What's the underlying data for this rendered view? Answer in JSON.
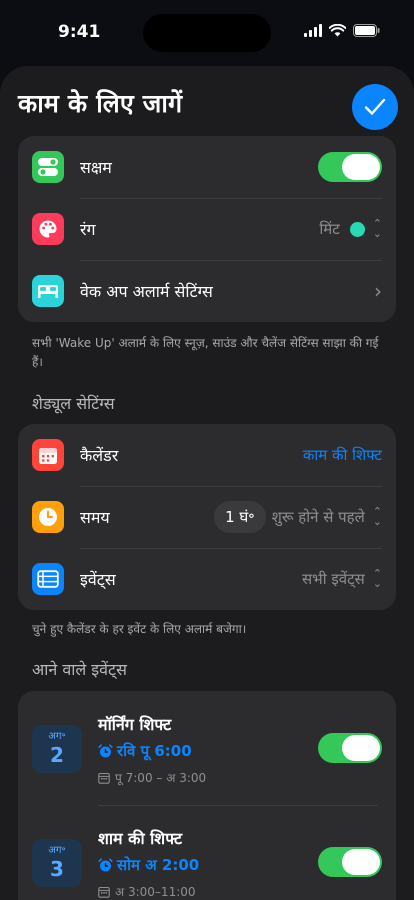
{
  "status_bar": {
    "time": "9:41"
  },
  "sheet": {
    "title": "काम के लिए जागें"
  },
  "settings": {
    "enabled_label": "सक्षम",
    "color_label": "रंग",
    "color_value": "मिंट",
    "wakeup_label": "वेक अप अलार्म सेटिंग्स",
    "footnote": "सभी 'Wake Up' अलार्म के लिए स्नूज़, साउंड और चैलेंज सेटिंग्स साझा की गई हैं।"
  },
  "schedule": {
    "header": "शेड्यूल सेटिंग्स",
    "calendar_label": "कैलेंडर",
    "calendar_value": "काम की शिफ्ट",
    "time_label": "समय",
    "time_hours": "1 घं॰",
    "time_value": "शुरू होने से पहले",
    "events_label": "इवेंट्स",
    "events_value": "सभी इवेंट्स",
    "footnote": "चुने हुए कैलेंडर के हर इवेंट के लिए अलार्म बजेगा।"
  },
  "upcoming": {
    "header": "आने वाले इवेंट्स",
    "events": [
      {
        "month": "अग॰",
        "day": "2",
        "title": "मॉर्निंग शिफ्ट",
        "alarm": "रवि पू 6:00",
        "time": "पू 7:00 – अ 3:00",
        "enabled": true
      },
      {
        "month": "अग॰",
        "day": "3",
        "title": "शाम की शिफ्ट",
        "alarm": "सोम अ 2:00",
        "time": "अ 3:00–11:00",
        "enabled": true
      }
    ]
  },
  "colors": {
    "accent": "#0a84ff",
    "toggle_on": "#34c759",
    "mint": "#28d9b5"
  }
}
